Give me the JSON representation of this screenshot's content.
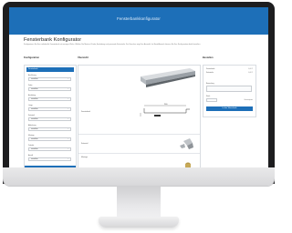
{
  "app": {
    "window_title": "Fensterbankkonfigurator",
    "page_title": "Fensterbank Konfigurator",
    "intro_text": "Konfigurieren Sie Ihre individuelle Fensterbank mit wenigen Klicks. Wählen Sie Material, Farbe, Ausladung und passende Seitenteile. Die Vorschau zeigt Ihre Auswahl. Im Bestellbereich können Sie Ihre Konfiguration direkt bestellen."
  },
  "columns": {
    "config": "Konfiguration",
    "preview": "Übersicht",
    "order": "Bestellen"
  },
  "config_panel": {
    "header": "Fensterbank",
    "fields": [
      {
        "label": "Ausführung",
        "value": "auswählen"
      },
      {
        "label": "Farbe",
        "value": "auswählen"
      },
      {
        "label": "Ausladung",
        "value": "auswählen"
      },
      {
        "label": "Länge",
        "value": "auswählen"
      },
      {
        "label": "Seitenteil",
        "value": "auswählen"
      },
      {
        "label": "Abdeckung",
        "value": "auswählen"
      },
      {
        "label": "Montage",
        "value": "auswählen"
      },
      {
        "label": "Zubehör",
        "value": "auswählen"
      },
      {
        "label": "Anzahl",
        "value": "auswählen"
      }
    ],
    "chevron_icon": "chevron-down-icon"
  },
  "preview": {
    "rows": [
      {
        "label": "Fensterbank"
      },
      {
        "label": "Seitenteil"
      },
      {
        "label": "Montage"
      }
    ],
    "dimension": "200"
  },
  "order": {
    "rows": [
      {
        "label": "Fensterbank",
        "value": "0,00 €"
      },
      {
        "label": "Seitenteile",
        "value": "0,00 €"
      }
    ],
    "comment_label": "Bemerkung",
    "qty_label": "Stück",
    "total_label": "Gesamtpreis",
    "button": "In den Warenkorb"
  },
  "colors": {
    "accent": "#1d6fb8",
    "monitor_bezel": "#1d1d1f",
    "stand": "#d8d8da"
  }
}
